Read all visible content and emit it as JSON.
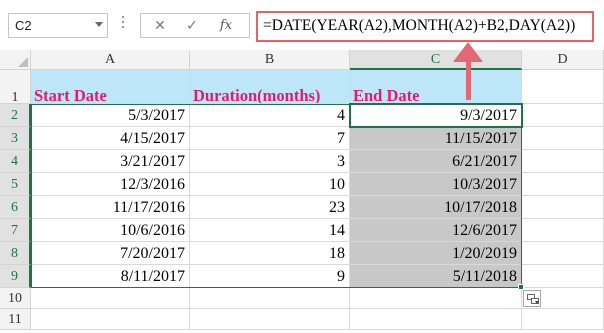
{
  "name_box": {
    "value": "C2"
  },
  "formula_bar": {
    "cancel_glyph": "✕",
    "enter_glyph": "✓",
    "fx_label": "fx",
    "formula": "=DATE(YEAR(A2),MONTH(A2)+B2,DAY(A2))"
  },
  "annotation": {
    "arrow_color": "#e06973",
    "highlight_color": "#e8606a"
  },
  "columns": [
    "A",
    "B",
    "C",
    "D"
  ],
  "rows": [
    "1",
    "2",
    "3",
    "4",
    "5",
    "6",
    "7",
    "8",
    "9",
    "10",
    "11"
  ],
  "headers": {
    "a": "Start Date",
    "b": "Duration(months)",
    "c": "End Date"
  },
  "data_rows": [
    {
      "start": "5/3/2017",
      "duration": "4",
      "end": "9/3/2017"
    },
    {
      "start": "4/15/2017",
      "duration": "7",
      "end": "11/15/2017"
    },
    {
      "start": "3/21/2017",
      "duration": "3",
      "end": "6/21/2017"
    },
    {
      "start": "12/3/2016",
      "duration": "10",
      "end": "10/3/2017"
    },
    {
      "start": "11/17/2016",
      "duration": "23",
      "end": "10/17/2018"
    },
    {
      "start": "10/6/2016",
      "duration": "14",
      "end": "12/6/2017"
    },
    {
      "start": "7/20/2017",
      "duration": "18",
      "end": "1/20/2019"
    },
    {
      "start": "8/11/2017",
      "duration": "9",
      "end": "5/11/2018"
    }
  ],
  "colors": {
    "header_fill": "#bde6f8",
    "header_text": "#e8196b",
    "result_fill": "#c8c8c8",
    "selection": "#217346"
  },
  "icons": {
    "quick_analysis": "quick-analysis-icon",
    "name_box_dropdown": "chevron-down-icon"
  }
}
